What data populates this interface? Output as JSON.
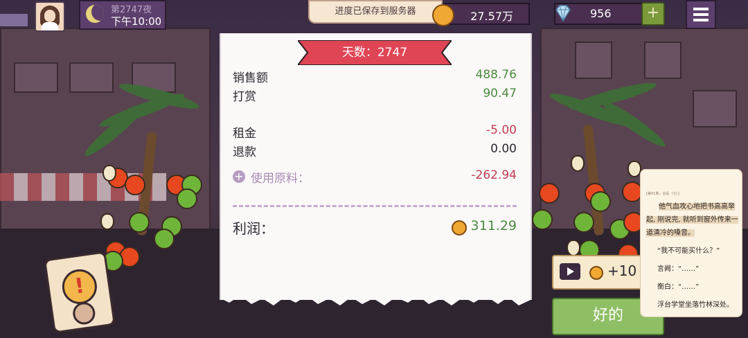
{
  "hud": {
    "night_label": "第2747夜",
    "time_label": "下午10:00",
    "toast": "进度已保存到服务器",
    "coins": "27.57万",
    "gems": "956",
    "add_label": "+"
  },
  "receipt": {
    "day_title": "天数：2747",
    "sales_label": "销售额",
    "sales_value": "488.76",
    "tips_label": "打赏",
    "tips_value": "90.47",
    "rent_label": "租金",
    "rent_value": "-5.00",
    "refund_label": "退款",
    "refund_value": "0.00",
    "materials_label": "使用原料：",
    "materials_value": "-262.94",
    "profit_label": "利润：",
    "profit_value": "311.29"
  },
  "ad": {
    "reward": "+10"
  },
  "ok_label": "好的",
  "reader": {
    "header": "[第41章，言后（七）]",
    "p1a": "他气血攻心地把书高高举",
    "p1b": "起, 刚说完, 就听到窗外传来一",
    "p1c": "道清冷的嗓音。",
    "p2": "“我不可能买什么？”",
    "p3": "言阙：“……”",
    "p4": "衡白：“……”",
    "p5": "浮台学堂坐落竹林深处。"
  },
  "colors": {
    "ribbon": "#e04556",
    "positive": "#4a8a40",
    "negative": "#c23b52"
  }
}
